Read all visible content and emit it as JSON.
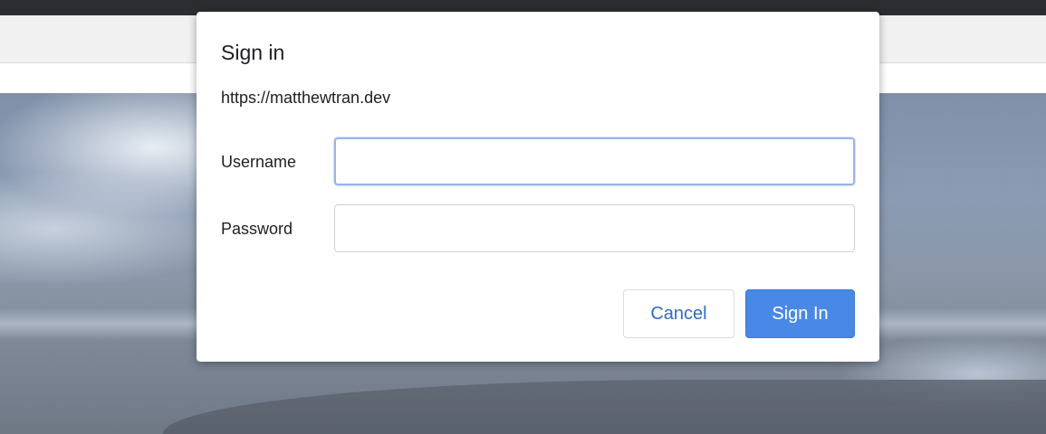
{
  "dialog": {
    "title": "Sign in",
    "origin": "https://matthewtran.dev",
    "username_label": "Username",
    "username_value": "",
    "password_label": "Password",
    "password_value": "",
    "cancel_label": "Cancel",
    "signin_label": "Sign In"
  },
  "colors": {
    "primary_button": "#4a88e8",
    "cancel_text": "#2f6bc4",
    "focus_ring": "#9ab4ea"
  }
}
